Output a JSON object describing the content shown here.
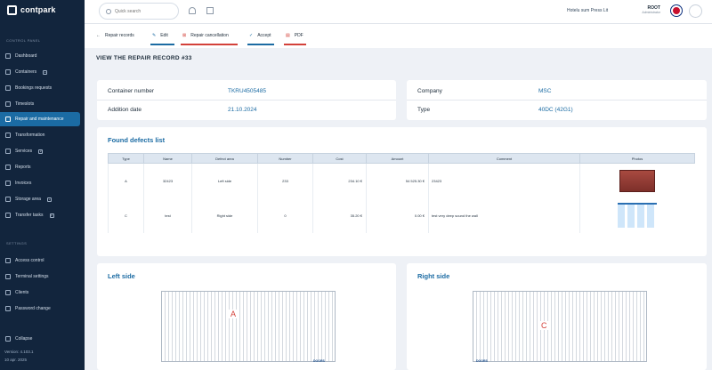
{
  "brand": "contpark",
  "search": {
    "placeholder": "Quick search"
  },
  "topbar": {
    "company": "Hotelu sum Press Lit",
    "user_name": "ROOT",
    "user_role": "Administrator"
  },
  "sidebar": {
    "section_main": "CONTROL PANEL",
    "items": [
      {
        "label": "Dashboard"
      },
      {
        "label": "Containers",
        "badge": "+"
      },
      {
        "label": "Bookings requests"
      },
      {
        "label": "Timeslots"
      },
      {
        "label": "Repair and maintenance",
        "active": true
      },
      {
        "label": "Transformation"
      },
      {
        "label": "Services",
        "badge": "2"
      },
      {
        "label": "Reports"
      },
      {
        "label": "Invoices"
      },
      {
        "label": "Storage area",
        "badge": "+"
      },
      {
        "label": "Transfer tasks",
        "badge": "2"
      }
    ],
    "section_settings": "SETTINGS",
    "settings_items": [
      {
        "label": "Access control"
      },
      {
        "label": "Terminal settings"
      },
      {
        "label": "Clients"
      },
      {
        "label": "Password change"
      }
    ],
    "collapse": "Collapse",
    "version": "Version: 4.103.1",
    "date": "10 apr. 2025"
  },
  "actions": {
    "back": "Repair records",
    "edit": "Edit",
    "cancel": "Repair cancellation",
    "accept": "Accept",
    "pdf": "PDF"
  },
  "page_title": "VIEW THE REPAIR RECORD #33",
  "record": {
    "container_label": "Container number",
    "container_value": "TKRU4505485",
    "date_label": "Addition date",
    "date_value": "21.10.2024",
    "company_label": "Company",
    "company_value": "MSC",
    "type_label": "Type",
    "type_value": "40DC (42G1)"
  },
  "defects": {
    "title": "Found defects list",
    "columns": [
      "Type",
      "Name",
      "Defect area",
      "Number",
      "Cost",
      "Amount",
      "Comment",
      "Photos"
    ],
    "rows": [
      {
        "type": "A",
        "name": "32423",
        "area": "Left side",
        "number": "233",
        "cost": "234.10 €",
        "amount": "54 525.30 €",
        "comment": "23423"
      },
      {
        "type": "C",
        "name": "test",
        "area": "Right side",
        "number": "0",
        "cost": "35.20 €",
        "amount": "0.00 €",
        "comment": "test very deep sound the wall"
      }
    ]
  },
  "sides": {
    "left_title": "Left side",
    "left_mark": "A",
    "right_title": "Right side",
    "right_mark": "C",
    "doors": "DOORS"
  }
}
